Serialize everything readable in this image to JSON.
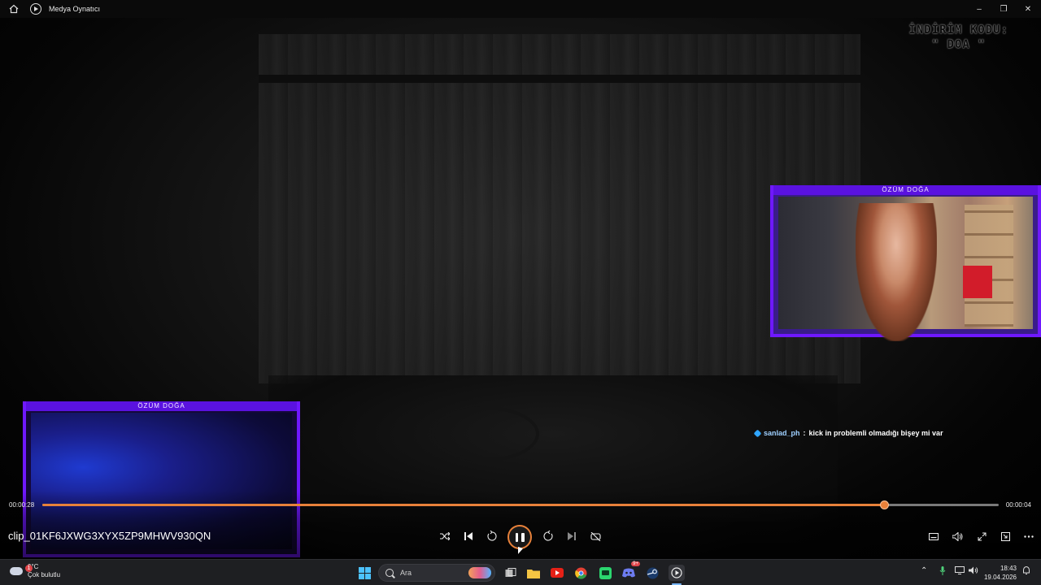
{
  "titlebar": {
    "app_title": "Medya Oynatıcı",
    "minimize": "–",
    "maximize": "❐",
    "close": "✕"
  },
  "video": {
    "watermark_line1": "İNDİRİM KODU:",
    "watermark_line2": "\" DOA \""
  },
  "webcams": {
    "right_label": "ÖZÜM DOĞA",
    "left_label": "ÖZÜM DOĞA"
  },
  "chat": {
    "username": "sanlad_ph",
    "separator": ":",
    "message": "kick in problemli olmadığı bişey mi var"
  },
  "player": {
    "elapsed": "00:00:28",
    "remaining": "00:00:04",
    "progress_fraction": 0.88,
    "clip_name": "clip_01KF6JXWG3XYX5ZP9MHWV930QN",
    "state": "playing",
    "accent_color": "#e8813a",
    "controls": {
      "shuffle": "shuffle-icon",
      "previous": "previous-icon",
      "skip_back": "10",
      "play_pause": "pause-icon",
      "skip_forward": "30",
      "next": "next-icon",
      "repeat": "repeat-off-icon",
      "subtitles": "captions-icon",
      "volume": "volume-icon",
      "fullscreen": "fullscreen-icon",
      "miniplayer": "miniplayer-icon",
      "more": "more-icon"
    }
  },
  "taskbar": {
    "weather_temp": "9°C",
    "weather_desc": "Çok bulutlu",
    "weather_badge": "1",
    "search_placeholder": "Ara",
    "discord_badge": "9+",
    "clock_time": "18:43",
    "clock_date": "19.04.2026"
  }
}
